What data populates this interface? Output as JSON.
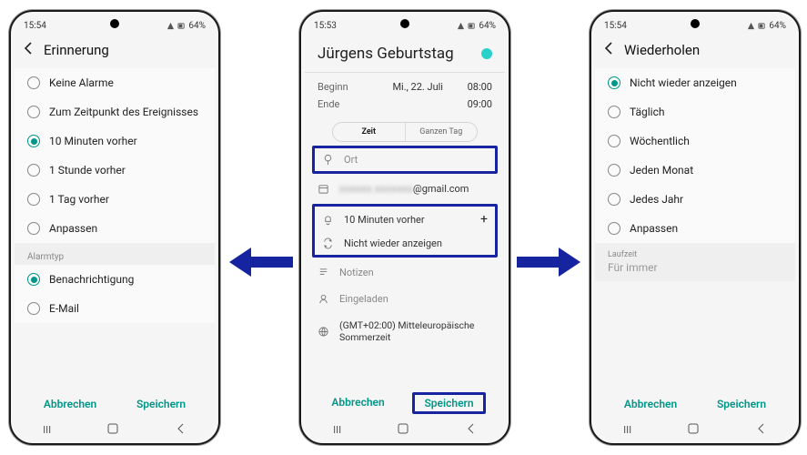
{
  "statusbar": {
    "time1": "15:54",
    "time2": "15:53",
    "time3": "15:54",
    "battery": "64%"
  },
  "phone1": {
    "title": "Erinnerung",
    "options": [
      "Keine Alarme",
      "Zum Zeitpunkt des Ereignisses",
      "10 Minuten vorher",
      "1 Stunde vorher",
      "1 Tag vorher",
      "Anpassen"
    ],
    "selected_index": 2,
    "alarm_type_label": "Alarmtyp",
    "alarm_types": [
      "Benachrichtigung",
      "E-Mail"
    ],
    "alarm_selected_index": 0
  },
  "phone2": {
    "event_title": "Jürgens Geburtstag",
    "begin_label": "Beginn",
    "end_label": "Ende",
    "date": "Mi., 22. Juli",
    "start_time": "08:00",
    "end_time": "09:00",
    "seg_time": "Zeit",
    "seg_allday": "Ganzen Tag",
    "location_label": "Ort",
    "account_suffix": "@gmail.com",
    "reminder_text": "10 Minuten vorher",
    "repeat_text": "Nicht wieder anzeigen",
    "notes_label": "Notizen",
    "invited_label": "Eingeladen",
    "tz_text": "(GMT+02:00) Mitteleuropäische Sommerzeit"
  },
  "phone3": {
    "title": "Wiederholen",
    "options": [
      "Nicht wieder anzeigen",
      "Täglich",
      "Wöchentlich",
      "Jeden Monat",
      "Jedes Jahr",
      "Anpassen"
    ],
    "selected_index": 0,
    "runtime_label": "Laufzeit",
    "runtime_value": "Für immer"
  },
  "buttons": {
    "cancel": "Abbrechen",
    "save": "Speichern"
  }
}
